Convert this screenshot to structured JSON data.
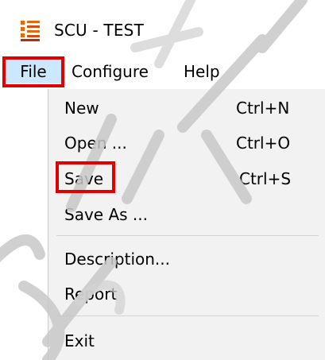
{
  "window": {
    "title": "SCU - TEST",
    "icon": "app-grid-icon"
  },
  "menu_bar": {
    "items": [
      {
        "label": "File"
      },
      {
        "label": "Configure"
      },
      {
        "label": "Help"
      }
    ]
  },
  "file_menu": {
    "items": [
      {
        "label": "New",
        "shortcut": "Ctrl+N"
      },
      {
        "label": "Open ...",
        "shortcut": "Ctrl+O"
      },
      {
        "label": "Save",
        "shortcut": "Ctrl+S"
      },
      {
        "label": "Save As ...",
        "shortcut": ""
      },
      {
        "label": "Description...",
        "shortcut": ""
      },
      {
        "label": "Report",
        "shortcut": ""
      },
      {
        "label": "Exit",
        "shortcut": ""
      }
    ]
  },
  "colors": {
    "highlight": "#e10000",
    "menu_hover": "#cce8ff",
    "dropdown_bg": "#f2f2f2",
    "watermark": "#c8c8c8"
  }
}
